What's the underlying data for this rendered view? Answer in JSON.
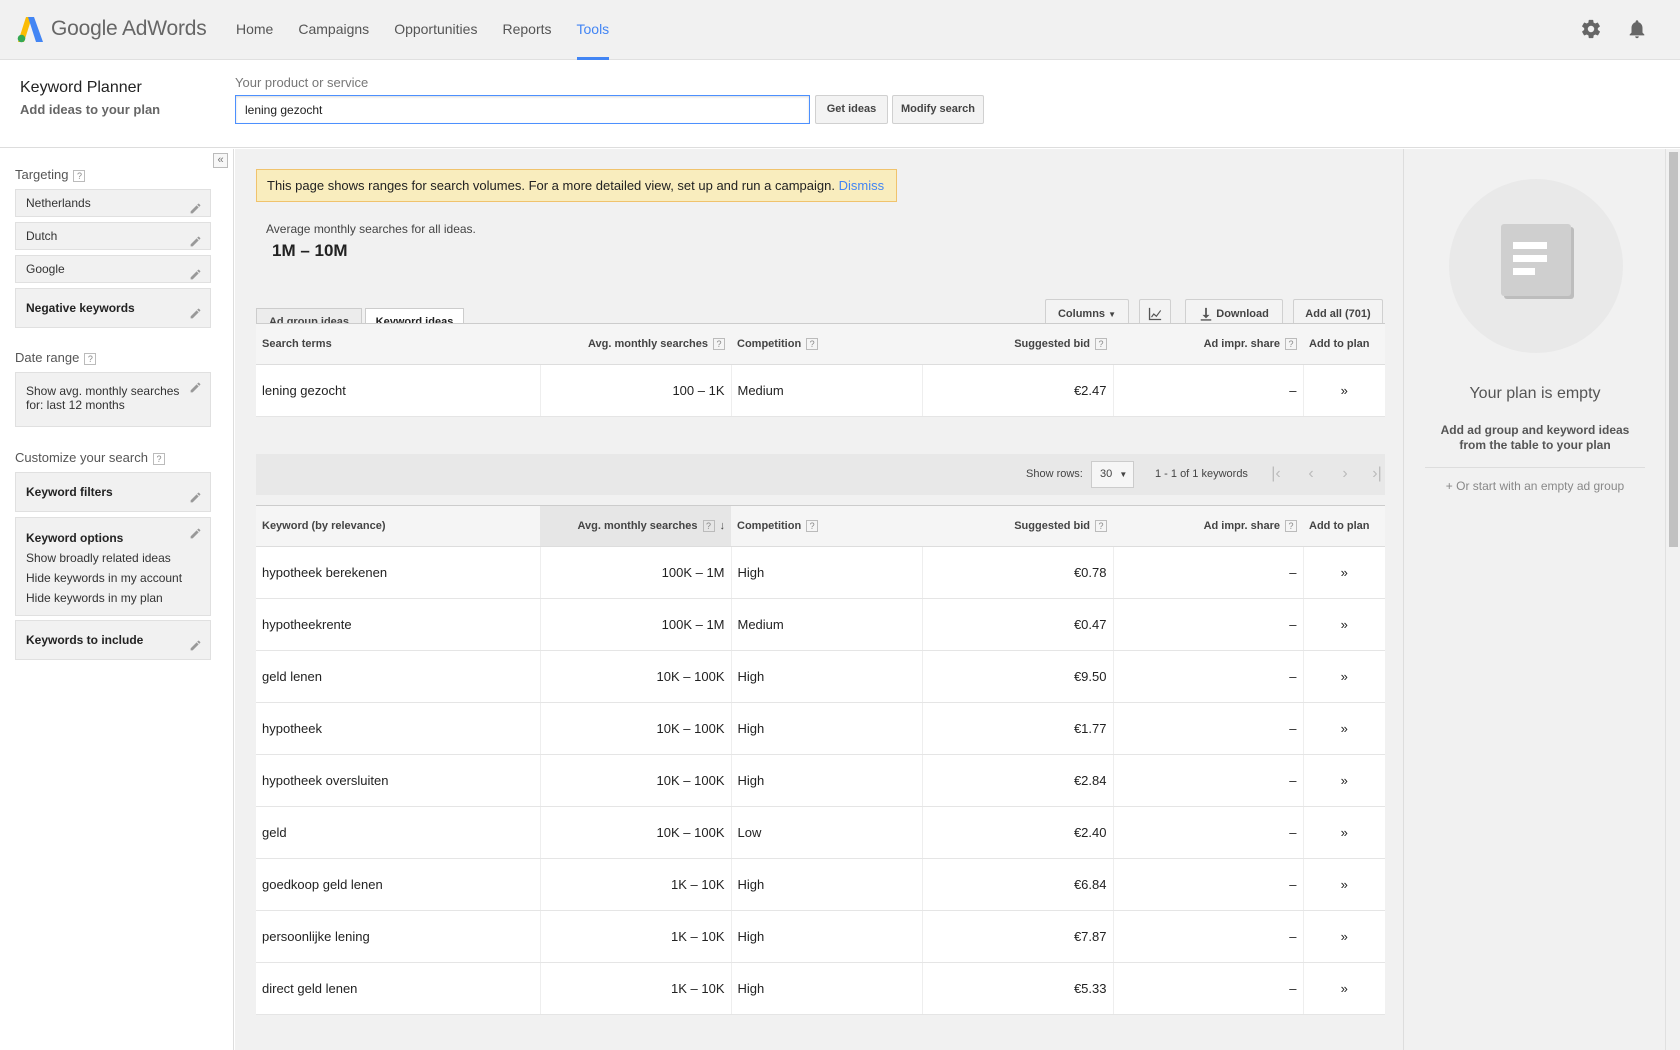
{
  "app": {
    "logo_text": "Google AdWords",
    "nav": [
      "Home",
      "Campaigns",
      "Opportunities",
      "Reports",
      "Tools"
    ],
    "active_nav": "Tools"
  },
  "header": {
    "title": "Keyword Planner",
    "subtitle": "Add ideas to your plan",
    "product_label": "Your product or service",
    "search_value": "lening gezocht",
    "get_ideas": "Get ideas",
    "modify_search": "Modify search"
  },
  "sidebar": {
    "collapse": "«",
    "targeting_title": "Targeting",
    "targeting": [
      "Netherlands",
      "Dutch",
      "Google"
    ],
    "negative_keywords": "Negative keywords",
    "date_range_title": "Date range",
    "date_range_value": "Show avg. monthly searches for: last 12 months",
    "customize_title": "Customize your search",
    "keyword_filters": "Keyword filters",
    "keyword_options_title": "Keyword options",
    "keyword_options": [
      "Show broadly related ideas",
      "Hide keywords in my account",
      "Hide keywords in my plan"
    ],
    "keywords_to_include": "Keywords to include"
  },
  "main": {
    "notice_text": "This page shows ranges for search volumes. For a more detailed view, set up and run a campaign.",
    "notice_dismiss": "Dismiss",
    "avg_label": "Average monthly searches for all ideas.",
    "avg_value": "1M – 10M",
    "tabs": [
      "Ad group ideas",
      "Keyword ideas"
    ],
    "active_tab": "Keyword ideas",
    "toolbar": {
      "columns": "Columns",
      "download": "Download",
      "add_all": "Add all (701)"
    },
    "search_terms_table": {
      "headers": [
        "Search terms",
        "Avg. monthly searches",
        "Competition",
        "Suggested bid",
        "Ad impr. share",
        "Add to plan"
      ],
      "rows": [
        {
          "term": "lening gezocht",
          "searches": "100 – 1K",
          "competition": "Medium",
          "bid": "€2.47",
          "share": "–"
        }
      ]
    },
    "pager": {
      "show_rows_label": "Show rows:",
      "rows_value": "30",
      "range_text": "1 - 1 of 1 keywords"
    },
    "keyword_table": {
      "headers": [
        "Keyword (by relevance)",
        "Avg. monthly searches",
        "Competition",
        "Suggested bid",
        "Ad impr. share",
        "Add to plan"
      ],
      "rows": [
        {
          "term": "hypotheek berekenen",
          "searches": "100K – 1M",
          "competition": "High",
          "bid": "€0.78",
          "share": "–"
        },
        {
          "term": "hypotheekrente",
          "searches": "100K – 1M",
          "competition": "Medium",
          "bid": "€0.47",
          "share": "–"
        },
        {
          "term": "geld lenen",
          "searches": "10K – 100K",
          "competition": "High",
          "bid": "€9.50",
          "share": "–"
        },
        {
          "term": "hypotheek",
          "searches": "10K – 100K",
          "competition": "High",
          "bid": "€1.77",
          "share": "–"
        },
        {
          "term": "hypotheek oversluiten",
          "searches": "10K – 100K",
          "competition": "High",
          "bid": "€2.84",
          "share": "–"
        },
        {
          "term": "geld",
          "searches": "10K – 100K",
          "competition": "Low",
          "bid": "€2.40",
          "share": "–"
        },
        {
          "term": "goedkoop geld lenen",
          "searches": "1K – 10K",
          "competition": "High",
          "bid": "€6.84",
          "share": "–"
        },
        {
          "term": "persoonlijke lening",
          "searches": "1K – 10K",
          "competition": "High",
          "bid": "€7.87",
          "share": "–"
        },
        {
          "term": "direct geld lenen",
          "searches": "1K – 10K",
          "competition": "High",
          "bid": "€5.33",
          "share": "–"
        }
      ]
    }
  },
  "plan": {
    "empty_title": "Your plan is empty",
    "help": "Add ad group and keyword ideas from the table to your plan",
    "start_link": "+ Or start with an empty ad group"
  },
  "colors": {
    "accent": "#4285f4",
    "notice_bg": "#f9edbe"
  }
}
